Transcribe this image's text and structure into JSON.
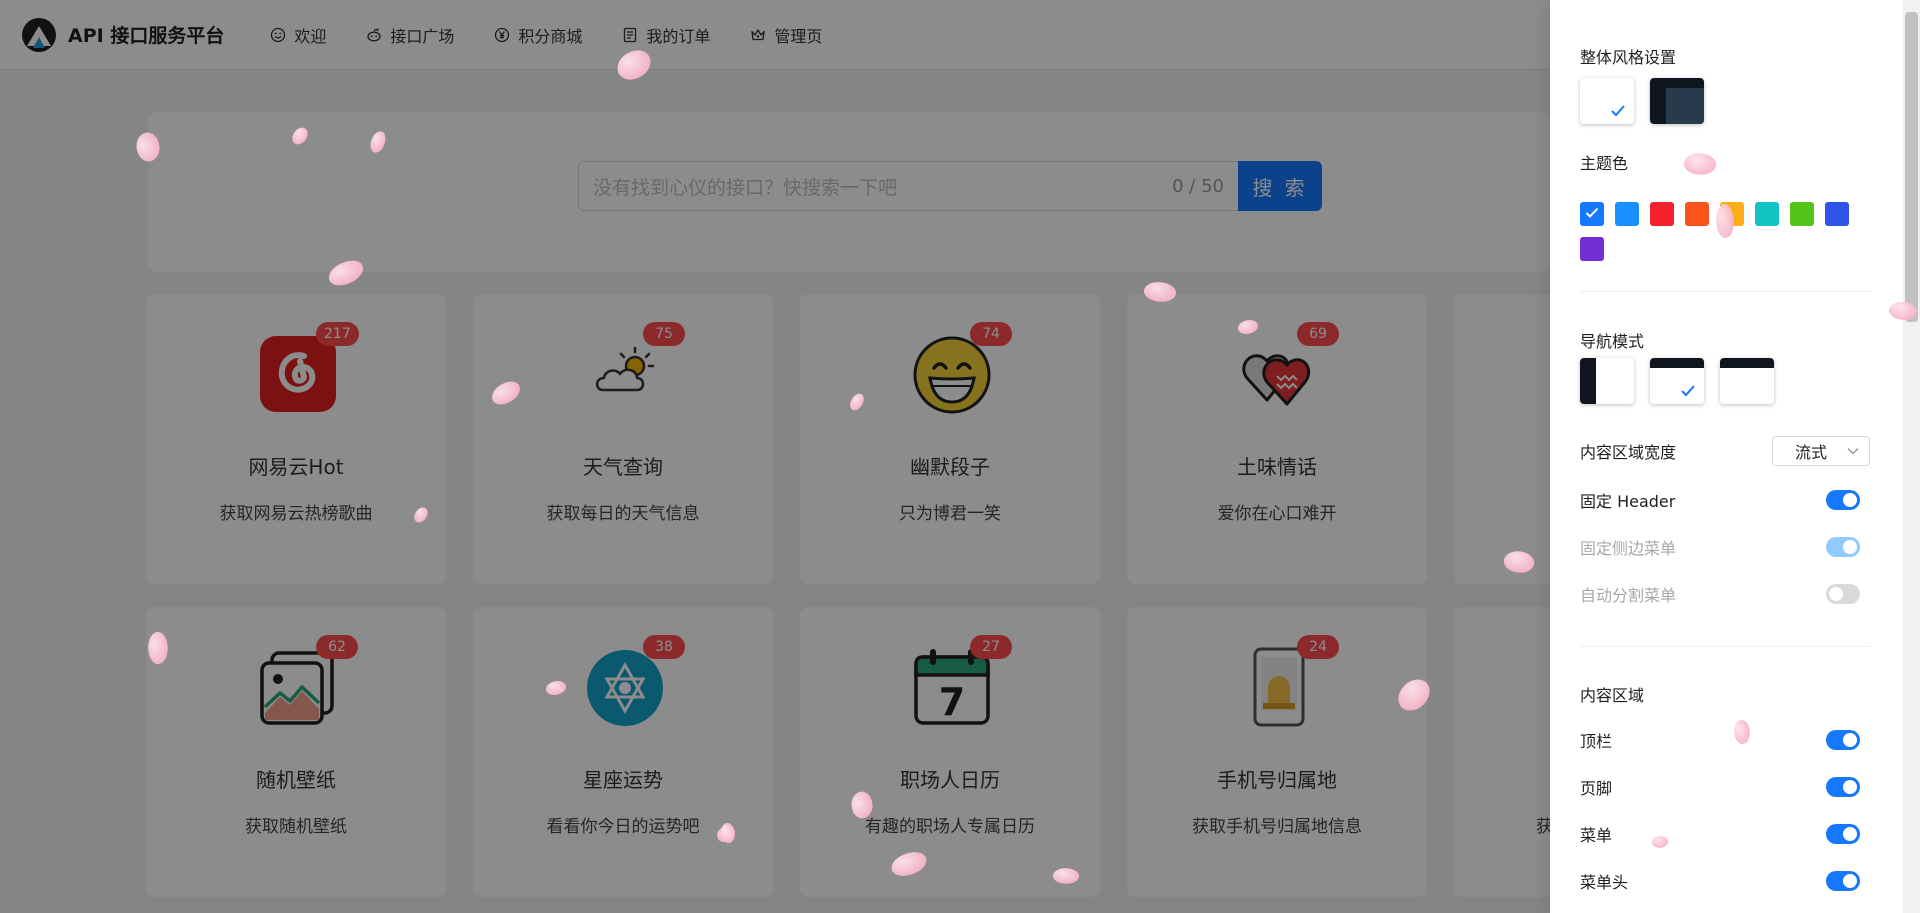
{
  "header": {
    "logo_text": "API 接口服务平台",
    "nav": [
      {
        "label": "欢迎",
        "icon": "smile-icon"
      },
      {
        "label": "接口广场",
        "icon": "reddit-icon"
      },
      {
        "label": "积分商城",
        "icon": "yen-icon"
      },
      {
        "label": "我的订单",
        "icon": "order-icon"
      },
      {
        "label": "管理页",
        "icon": "crown-icon"
      }
    ]
  },
  "search": {
    "placeholder": "没有找到心仪的接口？快搜索一下吧",
    "count": "0 / 50",
    "button": "搜 索"
  },
  "cards": [
    {
      "title": "网易云Hot",
      "desc": "获取网易云热榜歌曲",
      "badge": "217",
      "icon": "netease-music-icon"
    },
    {
      "title": "天气查询",
      "desc": "获取每日的天气信息",
      "badge": "75",
      "icon": "weather-icon"
    },
    {
      "title": "幽默段子",
      "desc": "只为博君一笑",
      "badge": "74",
      "icon": "laughing-face-icon"
    },
    {
      "title": "土味情话",
      "desc": "爱你在心口难开",
      "badge": "69",
      "icon": "hearts-icon"
    },
    {
      "title": "随机壁纸",
      "desc": "获取随机壁纸",
      "badge": "62",
      "icon": "wallpaper-icon"
    },
    {
      "title": "星座运势",
      "desc": "看看你今日的运势吧",
      "badge": "38",
      "icon": "zodiac-star-icon"
    },
    {
      "title": "职场人日历",
      "desc": "有趣的职场人专属日历",
      "badge": "27",
      "icon": "calendar-icon"
    },
    {
      "title": "手机号归属地",
      "desc": "获取手机号归属地信息",
      "badge": "24",
      "icon": "phone-location-icon"
    },
    {
      "title": "",
      "desc": "获",
      "badge": "",
      "icon": ""
    }
  ],
  "settings": {
    "page_style_title": "整体风格设置",
    "theme_color_title": "主题色",
    "theme_colors": [
      "#1677ff",
      "#1890ff",
      "#f5222d",
      "#fa541c",
      "#faad14",
      "#13c2c2",
      "#52c41a",
      "#2f54eb",
      "#722ed1"
    ],
    "nav_mode_title": "导航模式",
    "content_width_label": "内容区域宽度",
    "content_width_value": "流式",
    "fixed_header": "固定 Header",
    "fixed_sider": "固定侧边菜单",
    "split_menus": "自动分割菜单",
    "content_area_title": "内容区域",
    "top_bar": "顶栏",
    "footer": "页脚",
    "menu": "菜单",
    "menu_header": "菜单头"
  }
}
